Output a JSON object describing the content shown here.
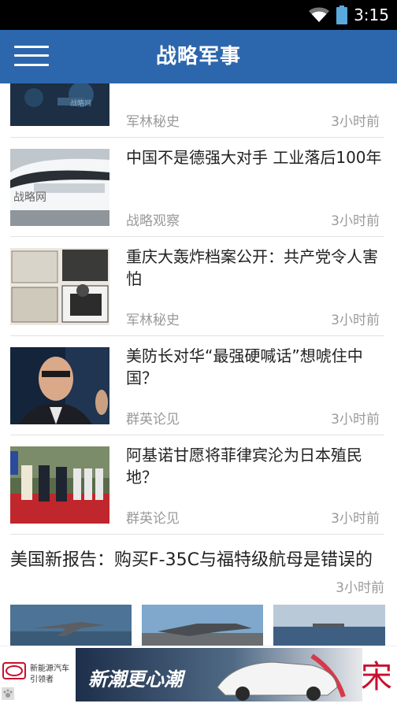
{
  "status_bar": {
    "time": "3:15"
  },
  "app_bar": {
    "title": "战略军事"
  },
  "feed": {
    "rows": [
      {
        "title": "",
        "source": "军林秘史",
        "time": "3小时前"
      },
      {
        "title": "中国不是德强大对手 工业落后100年",
        "source": "战略观察",
        "time": "3小时前"
      },
      {
        "title": "重庆大轰炸档案公开：共产党令人害怕",
        "source": "军林秘史",
        "time": "3小时前"
      },
      {
        "title": "美防长对华“最强硬喊话”想唬住中国？",
        "source": "群英论见",
        "time": "3小时前"
      },
      {
        "title": "阿基诺甘愿将菲律宾沦为日本殖民地？",
        "source": "群英论见",
        "time": "3小时前"
      }
    ],
    "big_item": {
      "title": "美国新报告：购买F-35C与福特级航母是错误的",
      "time": "3小时前"
    }
  },
  "ad": {
    "brand_small": "新能源汽车",
    "brand_small2": "引领者",
    "banner_text": "新潮更心潮",
    "side_char": "宋"
  },
  "colors": {
    "accent": "#2c67ad",
    "secondary_text": "#9a9a9a",
    "ad_red": "#c8102e"
  }
}
